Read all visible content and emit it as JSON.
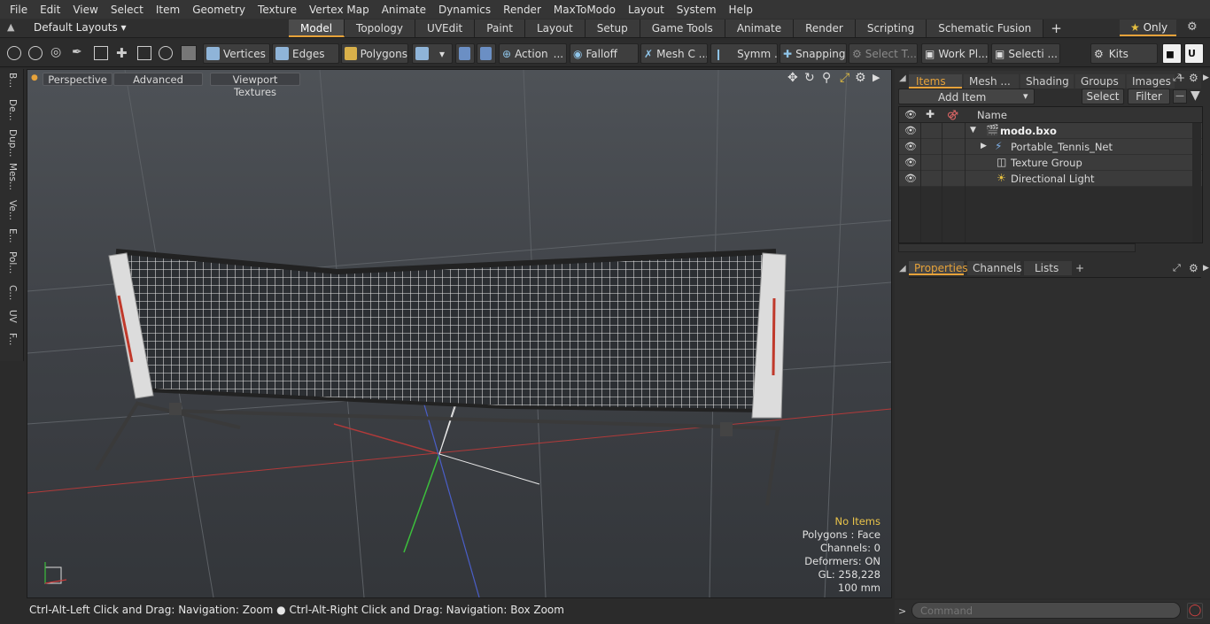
{
  "menu": [
    "File",
    "Edit",
    "View",
    "Select",
    "Item",
    "Geometry",
    "Texture",
    "Vertex Map",
    "Animate",
    "Dynamics",
    "Render",
    "MaxToModo",
    "Layout",
    "System",
    "Help"
  ],
  "layout_selector": "Default Layouts",
  "layout_tabs": [
    "Model",
    "Topology",
    "UVEdit",
    "Paint",
    "Layout",
    "Setup",
    "Game Tools",
    "Animate",
    "Render",
    "Scripting",
    "Schematic Fusion"
  ],
  "add_tab": "+",
  "only_label": "Only",
  "toolbar": {
    "vertices": "Vertices",
    "edges": "Edges",
    "polygons": "Polygons",
    "action": "Action",
    "falloff": "Falloff",
    "mesh": "Mesh C ...",
    "symmetry": "Symm ...",
    "snapping": "Snapping",
    "select_t": "Select T...",
    "work_plane": "Work Pl...",
    "selection": "Selecti ...",
    "kits": "Kits"
  },
  "left_tabs": [
    "B...",
    "De...",
    "Dup...",
    "Mes...",
    "Ve...",
    "E...",
    "Pol...",
    "C...",
    "UV",
    "F..."
  ],
  "viewport": {
    "perspective": "Perspective",
    "advanced": "Advanced",
    "viewport_textures": "Viewport Textures",
    "no_items": "No Items",
    "polygons": "Polygons : Face",
    "channels": "Channels: 0",
    "deformers": "Deformers: ON",
    "gl": "GL: 258,228",
    "scale": "100 mm"
  },
  "status_text": "Ctrl-Alt-Left Click and Drag: Navigation: Zoom ● Ctrl-Alt-Right Click and Drag: Navigation: Box Zoom",
  "items_panel": {
    "tabs": [
      "Items",
      "Mesh ...",
      "Shading",
      "Groups",
      "Images"
    ],
    "add_item": "Add Item",
    "select": "Select",
    "filter": "Filter",
    "col_name": "Name",
    "rows": [
      "modo.bxo",
      "Portable_Tennis_Net",
      "Texture Group",
      "Directional Light"
    ]
  },
  "properties_panel": {
    "tabs": [
      "Properties",
      "Channels",
      "Lists"
    ]
  },
  "command_placeholder": "Command",
  "colors": {
    "accent": "#e6a23a",
    "info_yellow": "#e8c34a"
  }
}
